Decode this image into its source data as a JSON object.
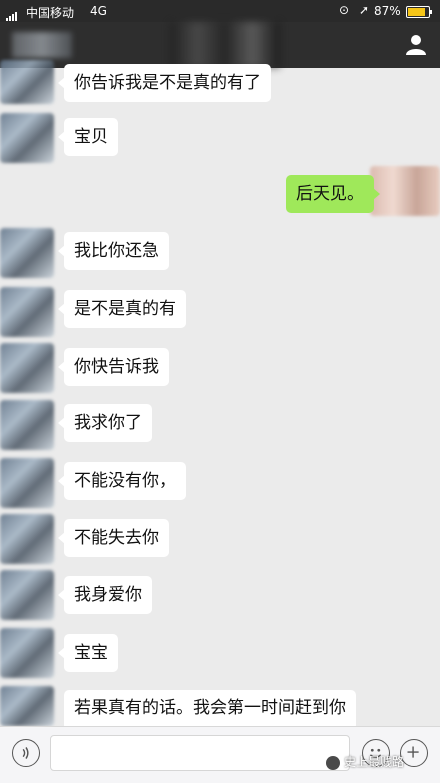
{
  "status_bar": {
    "carrier": "中国移动",
    "network": "4G",
    "battery_percent": "87%",
    "battery_level": 0.87,
    "battery_color": "#f5c518"
  },
  "nav": {
    "user_icon": "person-icon"
  },
  "messages": [
    {
      "side": "received",
      "text": "你告诉我是不是真的有了"
    },
    {
      "side": "received",
      "text": "宝贝"
    },
    {
      "side": "sent",
      "text": "后天见。"
    },
    {
      "side": "received",
      "text": "我比你还急"
    },
    {
      "side": "received",
      "text": "是不是真的有"
    },
    {
      "side": "received",
      "text": "你快告诉我"
    },
    {
      "side": "received",
      "text": "我求你了"
    },
    {
      "side": "received",
      "text": "不能没有你，"
    },
    {
      "side": "received",
      "text": "不能失去你"
    },
    {
      "side": "received",
      "text": "我身爱你"
    },
    {
      "side": "received",
      "text": "宝宝"
    },
    {
      "side": "received",
      "text": "若果真有的话。我会第一时间赶到你"
    }
  ],
  "input_bar": {
    "voice_icon": "voice-icon",
    "emoji_icon": "emoji-icon",
    "plus_icon": "plus-icon"
  },
  "watermark": {
    "text": "史上最贱路"
  },
  "colors": {
    "sent_bubble": "#9fe85a",
    "received_bubble": "#ffffff",
    "chat_bg": "#ebebeb",
    "nav_bg": "#2e2e2e"
  }
}
